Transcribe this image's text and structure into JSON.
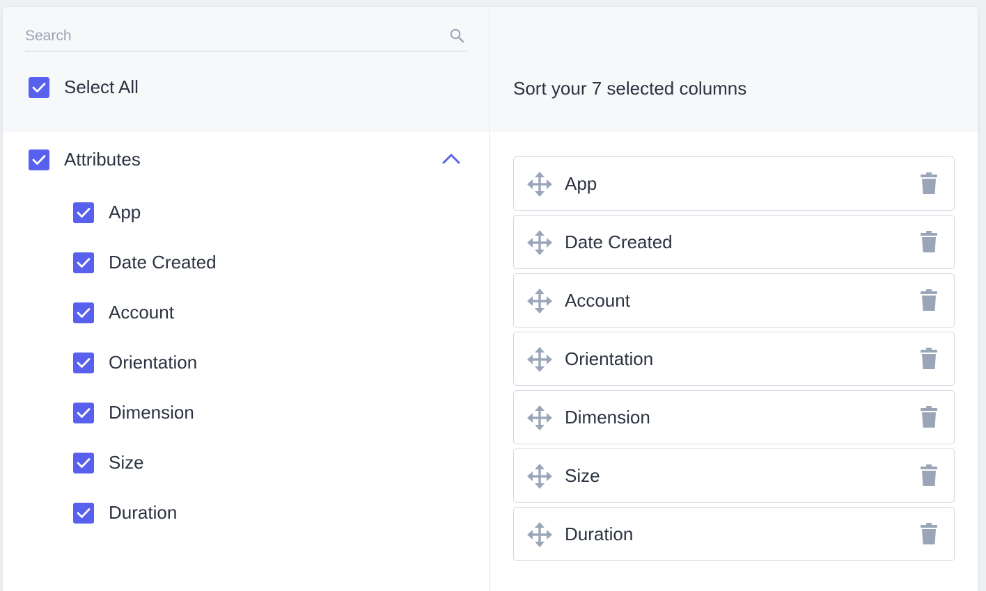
{
  "search": {
    "placeholder": "Search",
    "value": ""
  },
  "select_all": {
    "label": "Select All",
    "checked": true
  },
  "group": {
    "label": "Attributes",
    "checked": true,
    "expanded": true
  },
  "columns": [
    {
      "label": "App",
      "checked": true
    },
    {
      "label": "Date Created",
      "checked": true
    },
    {
      "label": "Account",
      "checked": true
    },
    {
      "label": "Orientation",
      "checked": true
    },
    {
      "label": "Dimension",
      "checked": true
    },
    {
      "label": "Size",
      "checked": true
    },
    {
      "label": "Duration",
      "checked": true
    }
  ],
  "sort": {
    "title": "Sort your 7 selected columns",
    "items": [
      "App",
      "Date Created",
      "Account",
      "Orientation",
      "Dimension",
      "Size",
      "Duration"
    ]
  },
  "icons": {
    "search": "search-icon",
    "check": "check-icon",
    "collapse": "chevron-up-icon",
    "move": "move-handle-icon",
    "delete": "trash-icon"
  },
  "colors": {
    "accent": "#5860ee",
    "icon_muted": "#9aa5b8",
    "header_bg": "#f7f8fa",
    "border": "#d3d8e1"
  }
}
